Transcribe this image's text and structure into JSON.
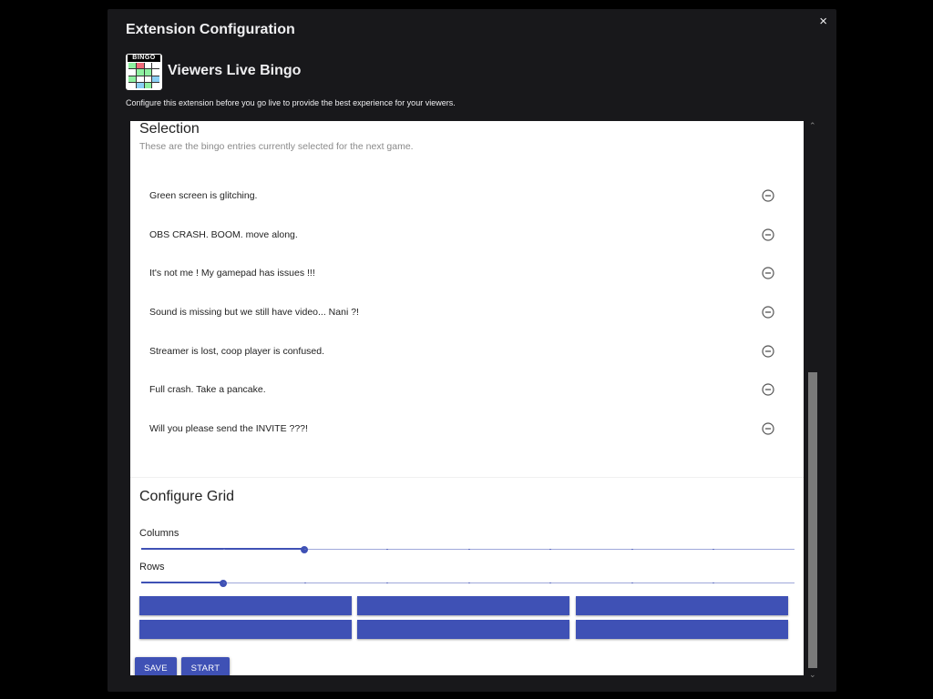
{
  "modal": {
    "title": "Extension Configuration",
    "close_label": "×",
    "app_name": "Viewers Live Bingo",
    "app_icon_banner": "BINGO",
    "description": "Configure this extension before you go live to provide the best experience for your viewers."
  },
  "selection": {
    "title": "Selection",
    "subtitle": "These are the bingo entries currently selected for the next game.",
    "items": [
      "Green screen is glitching.",
      "OBS CRASH. BOOM. move along.",
      "It's not me ! My gamepad has issues !!!",
      "Sound is missing but we still have video... Nani ?!",
      "Streamer is lost, coop player is confused.",
      "Full crash. Take a pancake.",
      "Will you please send the INVITE ???!"
    ],
    "remove_icon": "minus-circle-icon"
  },
  "grid": {
    "title": "Configure Grid",
    "columns_label": "Columns",
    "columns_value_fraction": 0.25,
    "rows_label": "Rows",
    "rows_value_fraction": 0.125,
    "slider_steps": 8
  },
  "buttons": {
    "save_label": "SAVE",
    "start_label": "START"
  },
  "colors": {
    "accent": "#3f51b5",
    "modal_bg": "#18181b",
    "icon_green": "#8ef0a0",
    "icon_red": "#f06a7a",
    "icon_blue": "#8ad0f5"
  }
}
